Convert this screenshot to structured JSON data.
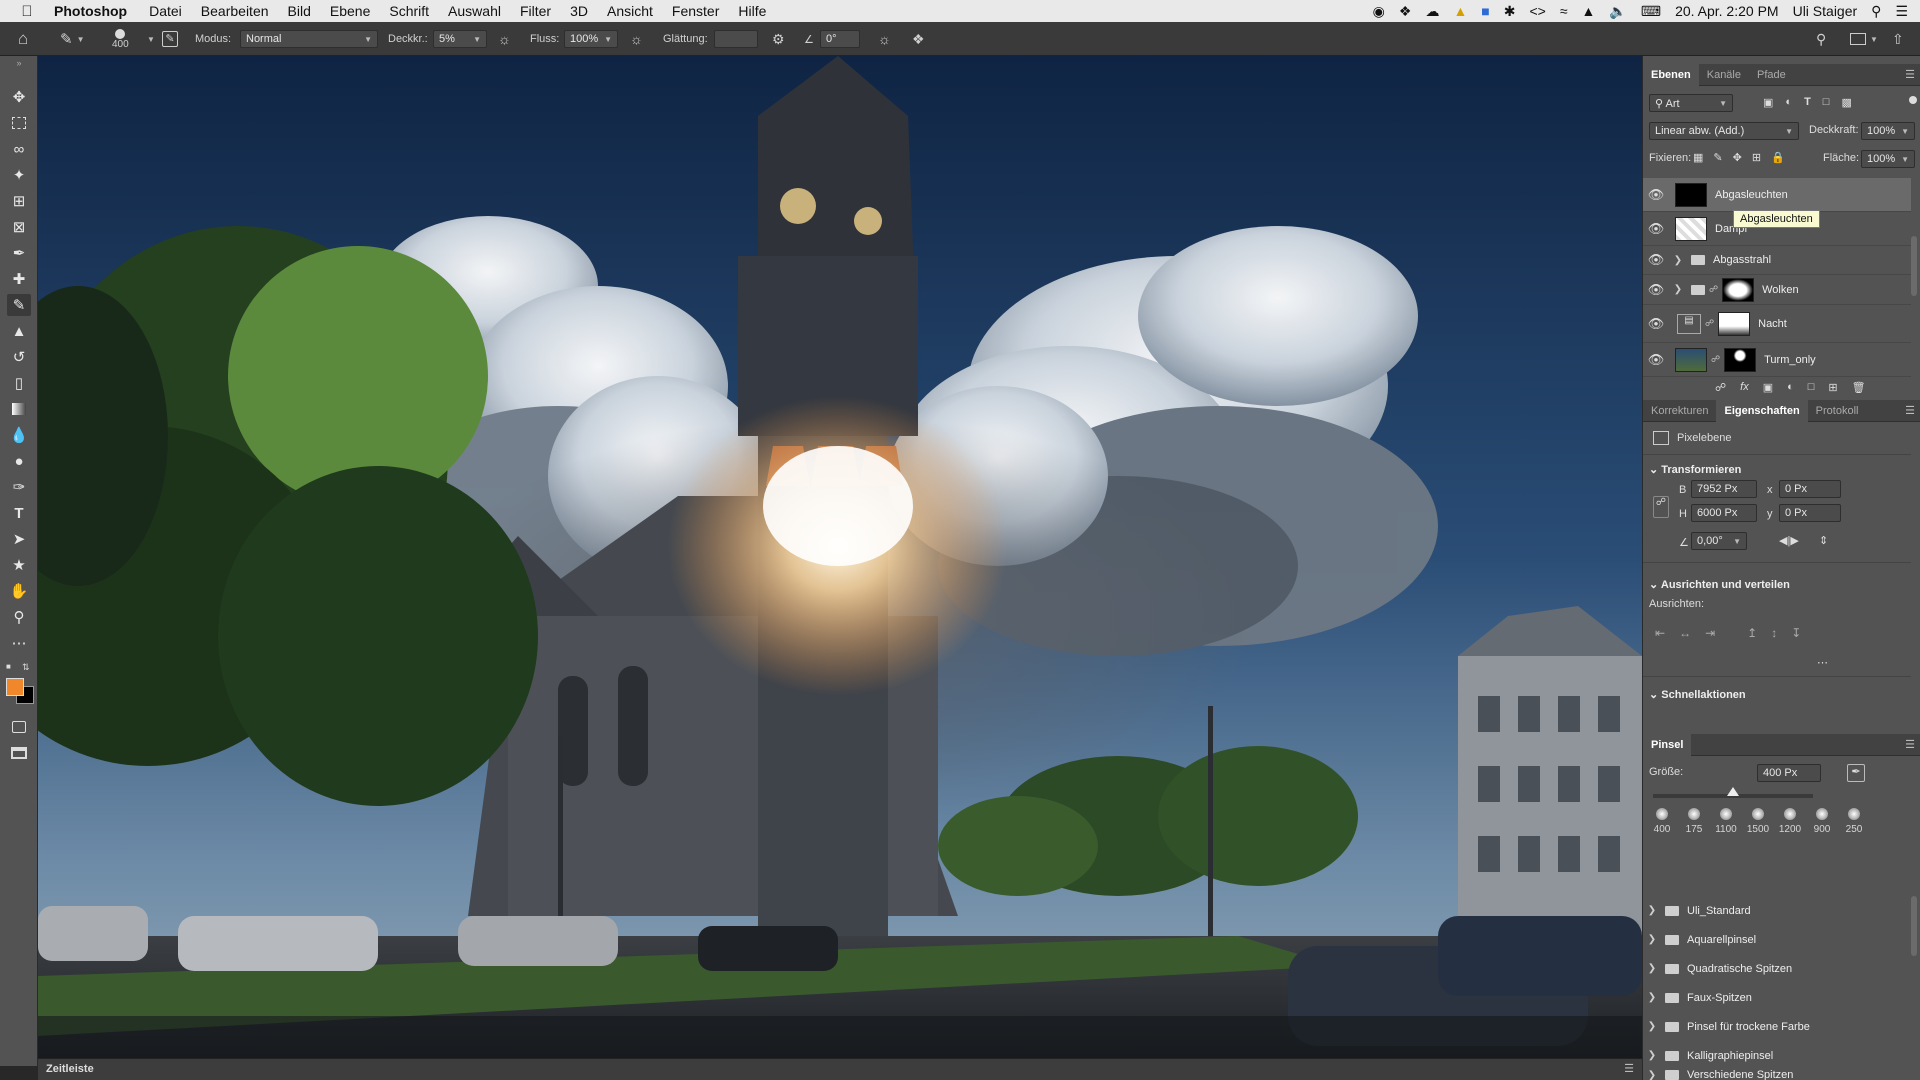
{
  "menubar": {
    "app": "Photoshop",
    "items": [
      "Datei",
      "Bearbeiten",
      "Bild",
      "Ebene",
      "Schrift",
      "Auswahl",
      "Filter",
      "3D",
      "Ansicht",
      "Fenster",
      "Hilfe"
    ],
    "datetime": "20. Apr. 2:20 PM",
    "user": "Uli Staiger"
  },
  "options": {
    "brush_size": "400",
    "mode_label": "Modus:",
    "mode_value": "Normal",
    "opacity_label": "Deckkr.:",
    "opacity_value": "5%",
    "flow_label": "Fluss:",
    "flow_value": "100%",
    "smoothing_label": "Glättung:",
    "angle_value": "0°"
  },
  "layers_panel": {
    "tabs": [
      "Ebenen",
      "Kanäle",
      "Pfade"
    ],
    "filter_label": "Art",
    "blend_mode": "Linear abw. (Add.)",
    "opacity_label": "Deckkraft:",
    "opacity_value": "100%",
    "lock_label": "Fixieren:",
    "fill_label": "Fläche:",
    "fill_value": "100%",
    "tooltip": "Abgasleuchten",
    "layers": [
      {
        "name": "Abgasleuchten"
      },
      {
        "name": "Dampf"
      },
      {
        "name": "Abgasstrahl"
      },
      {
        "name": "Wolken"
      },
      {
        "name": "Nacht"
      },
      {
        "name": "Turm_only"
      }
    ]
  },
  "properties_panel": {
    "tabs": [
      "Korrekturen",
      "Eigenschaften",
      "Protokoll"
    ],
    "layer_type": "Pixelebene",
    "transform_title": "Transformieren",
    "w_label": "B",
    "w_value": "7952 Px",
    "h_label": "H",
    "h_value": "6000 Px",
    "x_label": "x",
    "x_value": "0 Px",
    "y_label": "y",
    "y_value": "0 Px",
    "angle_value": "0,00°",
    "align_title": "Ausrichten und verteilen",
    "align_label": "Ausrichten:",
    "quick_title": "Schnellaktionen"
  },
  "brush_panel": {
    "title": "Pinsel",
    "size_label": "Größe:",
    "size_value": "400 Px",
    "size_level": 0.5,
    "presets": [
      "400",
      "175",
      "1100",
      "1500",
      "1200",
      "900",
      "250"
    ],
    "folders": [
      "Uli_Standard",
      "Aquarellpinsel",
      "Quadratische Spitzen",
      "Faux-Spitzen",
      "Pinsel für trockene Farbe",
      "Kalligraphiepinsel",
      "Verschiedene Spitzen"
    ]
  },
  "timeline": {
    "label": "Zeitleiste"
  },
  "colors": {
    "foreground": "#f0872a",
    "background": "#000000",
    "accent": "#2d6ad6"
  }
}
